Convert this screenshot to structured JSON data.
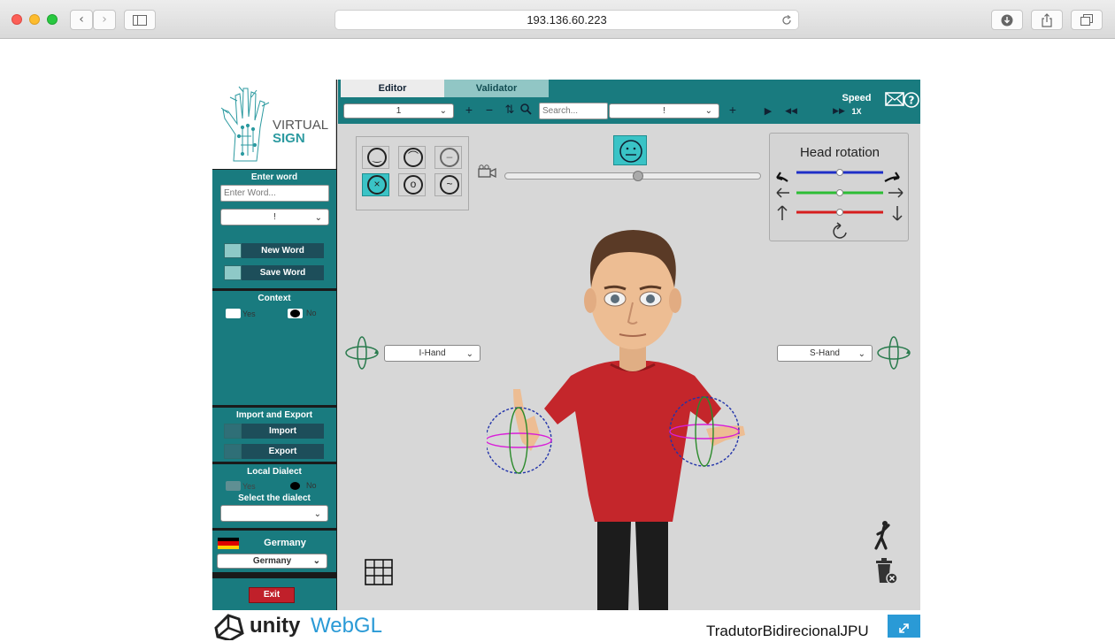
{
  "browser": {
    "url": "193.136.60.223",
    "colors": {
      "close": "#fc5f57",
      "minimize": "#fdbc2e",
      "zoom": "#28c840"
    }
  },
  "sidebar": {
    "logo_line1": "VIRTUAL",
    "logo_line2": "SIGN",
    "enter_word_title": "Enter word",
    "word_placeholder": "Enter Word...",
    "word_dropdown_value": "!",
    "new_word": "New Word",
    "save_word": "Save Word",
    "context_title": "Context",
    "context_yes": "Yes",
    "context_no": "No",
    "import_export_title": "Import and Export",
    "import": "Import",
    "export": "Export",
    "local_dialect_title": "Local Dialect",
    "dialect_yes": "Yes",
    "dialect_no": "No",
    "select_dialect_title": "Select the dialect",
    "dialect_value": "",
    "country_label": "Germany",
    "country_value": "Germany",
    "exit": "Exit"
  },
  "toolbar": {
    "tabs": [
      {
        "label": "Editor"
      },
      {
        "label": "Validator"
      }
    ],
    "frame_dropdown": "1",
    "search_placeholder": "Search...",
    "sign_dropdown": "!",
    "speed_label": "Speed",
    "speed_value": "1X"
  },
  "viewport": {
    "head_rotation_title": "Head rotation",
    "left_hand_dropdown": "I-Hand",
    "right_hand_dropdown": "S-Hand",
    "accent_color": "#197b7f",
    "selected_color": "#3ac3c6",
    "faces": [
      "happy",
      "sad",
      "neutral",
      "angry",
      "surprised",
      "worried"
    ]
  },
  "footer": {
    "unity_text": "unity",
    "webgl_text": "WebGL",
    "project_name": "TradutorBidirecionalJPU"
  }
}
